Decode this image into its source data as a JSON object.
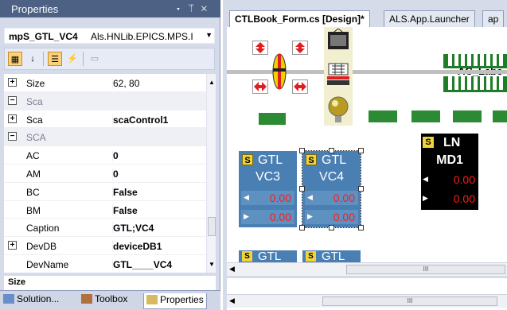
{
  "properties_panel": {
    "title": "Properties",
    "title_buttons": [
      "▾",
      "ᛘ",
      "✕"
    ],
    "object_name": "mpS_GTL_VC4",
    "object_type": "Als.HNLib.EPICS.MPS.I",
    "rows": [
      {
        "kind": "prop",
        "expander": "⊞",
        "name": "Size",
        "value": "62, 80",
        "bold": false
      },
      {
        "kind": "cat",
        "expander": "⊟",
        "name": "Sca",
        "value": ""
      },
      {
        "kind": "prop",
        "expander": "⊞",
        "name": "Sca",
        "value": "scaControl1",
        "bold": true
      },
      {
        "kind": "cat",
        "expander": "⊟",
        "name": "SCA",
        "value": ""
      },
      {
        "kind": "prop",
        "expander": "",
        "name": "AC",
        "value": "0",
        "bold": true
      },
      {
        "kind": "prop",
        "expander": "",
        "name": "AM",
        "value": "0",
        "bold": true
      },
      {
        "kind": "prop",
        "expander": "",
        "name": "BC",
        "value": "False",
        "bold": true
      },
      {
        "kind": "prop",
        "expander": "",
        "name": "BM",
        "value": "False",
        "bold": true
      },
      {
        "kind": "prop",
        "expander": "",
        "name": "Caption",
        "value": "GTL;VC4",
        "bold": true
      },
      {
        "kind": "prop",
        "expander": "⊞",
        "name": "DevDB",
        "value": "deviceDB1",
        "bold": true
      },
      {
        "kind": "prop",
        "expander": "",
        "name": "DevName",
        "value": "GTL____VC4",
        "bold": true
      }
    ],
    "description": "Size",
    "bottom_tabs": [
      {
        "label": "Solution...",
        "icon": "solution-explorer-icon"
      },
      {
        "label": "Toolbox",
        "icon": "toolbox-icon"
      },
      {
        "label": "Properties",
        "icon": "properties-icon",
        "selected": true
      }
    ]
  },
  "documents": {
    "tabs": [
      {
        "label": "CTLBook_Form.cs [Design]*",
        "selected": true
      },
      {
        "label": "ALS.App.Launcher",
        "selected": false
      },
      {
        "label": "ap",
        "selected": false
      }
    ],
    "ac_label": "AC_Labe",
    "gtl_vc3": {
      "s": "S",
      "line1": "GTL",
      "line2": "VC3",
      "value_a": "0.00",
      "value_b": "0.00"
    },
    "gtl_vc4": {
      "s": "S",
      "line1": "GTL",
      "line2": "VC4",
      "value_a": "0.00",
      "value_b": "0.00"
    },
    "ln_md1": {
      "s": "S",
      "line1": "LN",
      "line2": "MD1",
      "value_a": "0.00",
      "value_b": "0.00"
    },
    "stubs": [
      {
        "s": "S",
        "label": "GTL"
      },
      {
        "s": "S",
        "label": "GTL"
      }
    ],
    "scroll_grip": "III"
  },
  "colors": {
    "accent_blue": "#4a7fb3",
    "value_red": "#ff1c1c",
    "rail_green": "#2d8a34",
    "title_bar": "#4d6185"
  }
}
